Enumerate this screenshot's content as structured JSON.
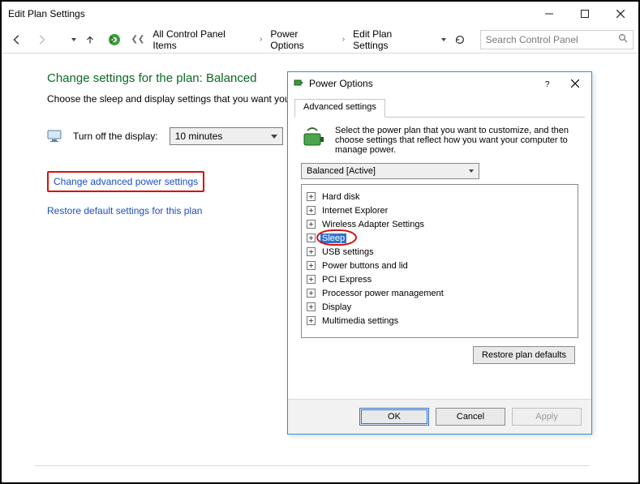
{
  "window": {
    "title": "Edit Plan Settings"
  },
  "nav": {
    "crumbs": [
      "All Control Panel Items",
      "Power Options",
      "Edit Plan Settings"
    ],
    "search_placeholder": "Search Control Panel"
  },
  "main": {
    "heading": "Change settings for the plan: Balanced",
    "subtext": "Choose the sleep and display settings that you want your computer to use.",
    "display_off_label": "Turn off the display:",
    "display_off_value": "10 minutes",
    "link_adv": "Change advanced power settings",
    "link_restore": "Restore default settings for this plan"
  },
  "dialog": {
    "title": "Power Options",
    "tab": "Advanced settings",
    "intro": "Select the power plan that you want to customize, and then choose settings that reflect how you want your computer to manage power.",
    "plan_selected": "Balanced [Active]",
    "tree": [
      "Hard disk",
      "Internet Explorer",
      "Wireless Adapter Settings",
      "Sleep",
      "USB settings",
      "Power buttons and lid",
      "PCI Express",
      "Processor power management",
      "Display",
      "Multimedia settings"
    ],
    "selected_index": 3,
    "restore_btn": "Restore plan defaults",
    "ok": "OK",
    "cancel": "Cancel",
    "apply": "Apply"
  }
}
